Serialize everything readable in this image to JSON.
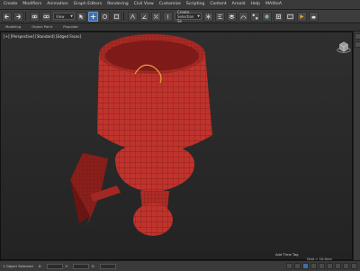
{
  "menu": {
    "items": [
      "Create",
      "Modifiers",
      "Animation",
      "Graph Editors",
      "Rendering",
      "Civil View",
      "Customize",
      "Scripting",
      "Content",
      "Arnold",
      "Help",
      "MAXtoA"
    ]
  },
  "toolbar": {
    "view_dropdown": "View",
    "selection_set_placeholder": "Create Selection Se"
  },
  "ribbon": {
    "tabs": [
      "Modeling",
      "Object Paint",
      "Populate"
    ]
  },
  "viewport": {
    "label": "[+] [Perspective] [Standard] [Edged Faces]"
  },
  "status": {
    "object_count": "1 Object Selected",
    "grid": "Grid = 10.0cm",
    "add_time_tag": "Add Time Tag",
    "coord_x": "X:",
    "coord_y": "Y:",
    "coord_z": "Z:"
  },
  "colors": {
    "model_fill": "#c0332d",
    "model_wire": "#5a0f0d",
    "model_shadow": "#8a1f1b",
    "viewport_bg": "#2a2a2a",
    "accent_blue": "#3f6fa6"
  },
  "icons": [
    "undo-icon",
    "redo-icon",
    "link-icon",
    "unlink-icon",
    "select-icon",
    "move-icon",
    "rotate-icon",
    "scale-icon",
    "snap-icon",
    "render-icon",
    "viewcube-icon",
    "play-icon"
  ]
}
